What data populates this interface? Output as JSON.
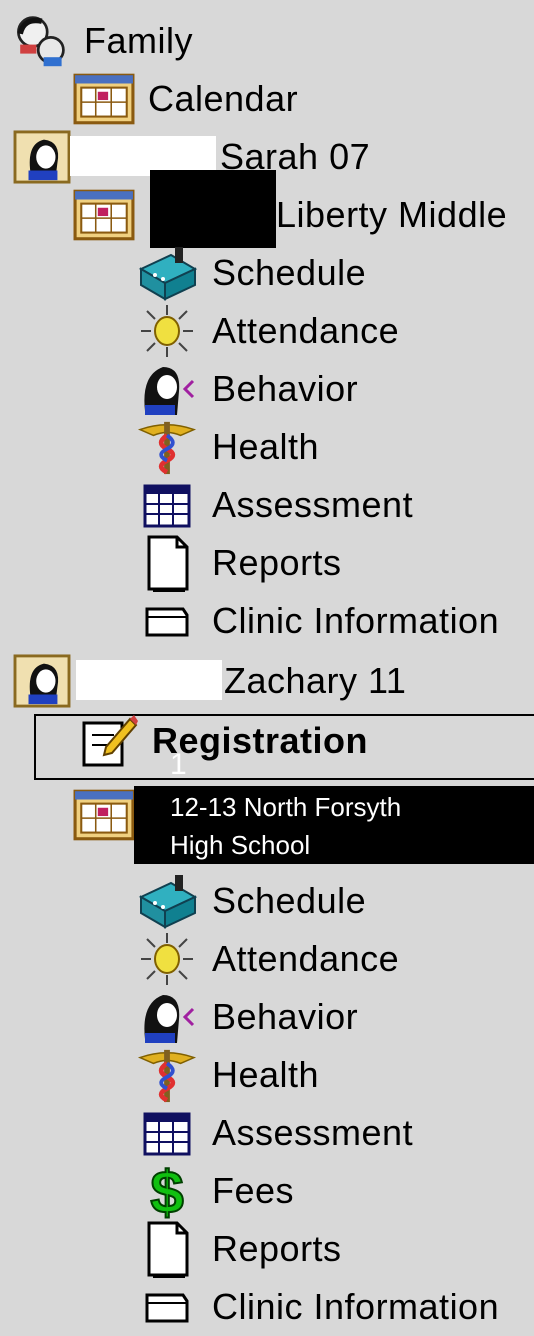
{
  "tree": {
    "family": {
      "label": "Family"
    },
    "calendar": {
      "label": "Calendar"
    },
    "student1": {
      "name": "Sarah 07",
      "school": "Liberty Middle",
      "items": [
        "Schedule",
        "Attendance",
        "Behavior",
        "Health",
        "Assessment",
        "Reports",
        "Clinic Information"
      ]
    },
    "student2": {
      "name": "Zachary 11",
      "registration": "Registration",
      "items": [
        "Schedule",
        "Attendance",
        "Behavior",
        "Health",
        "Assessment",
        "Fees",
        "Reports",
        "Clinic Information"
      ]
    }
  },
  "tooltip": {
    "text": "12-13 North Forsyth High School",
    "line1": "12-13 North Forsyth",
    "line2": "High School",
    "ghost": "1"
  },
  "icons": {
    "family": "family-icon",
    "calendar": "calendar-icon",
    "student": "student-icon",
    "schedule": "schedule-icon",
    "attendance": "attendance-icon",
    "behavior": "behavior-icon",
    "health": "health-icon",
    "assessment": "assessment-icon",
    "fees": "fees-icon",
    "reports": "reports-icon",
    "clinic": "clinic-icon",
    "registration": "registration-icon"
  },
  "colors": {
    "background": "#d8d8d8",
    "calendar_frame": "#b07a2a",
    "fees": "#10b010",
    "health_red": "#e03030",
    "teal": "#20a0a0"
  }
}
